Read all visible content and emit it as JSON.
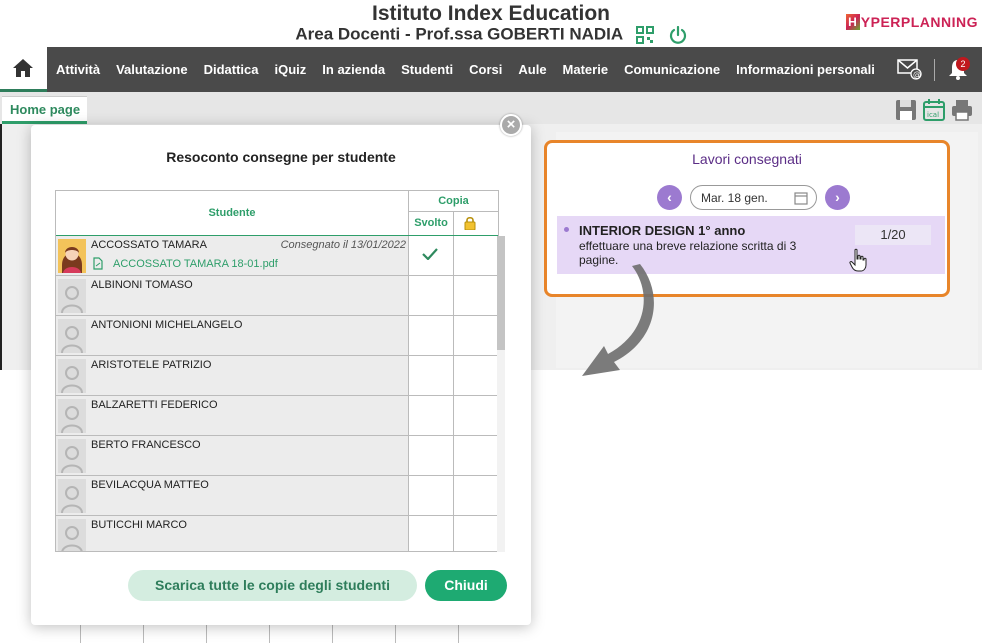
{
  "header": {
    "school": "Istituto Index Education",
    "user": "Area Docenti - Prof.ssa GOBERTI NADIA",
    "logo": "HYPERPLANNING"
  },
  "nav": {
    "items": [
      "Attività",
      "Valutazione",
      "Didattica",
      "iQuiz",
      "In azienda",
      "Studenti",
      "Corsi",
      "Aule",
      "Materie",
      "Comunicazione",
      "Informazioni personali"
    ],
    "notifications": "2"
  },
  "tabs": {
    "home": "Home page"
  },
  "lavori": {
    "title": "Lavori consegnati",
    "date": "Mar. 18 gen.",
    "item_title": "INTERIOR DESIGN 1° anno",
    "item_desc": "effettuare una breve relazione scritta di 3 pagine.",
    "item_count": "1/20"
  },
  "modal": {
    "title": "Resoconto consegne per studente",
    "col_student": "Studente",
    "col_copia": "Copia",
    "col_svolto": "Svolto",
    "students": [
      {
        "name": "ACCOSSATO TAMARA",
        "status": "Consegnato il 13/01/2022",
        "file": "ACCOSSATO TAMARA 18-01.pdf",
        "svolto": true
      },
      {
        "name": "ALBINONI TOMASO"
      },
      {
        "name": "ANTONIONI MICHELANGELO"
      },
      {
        "name": "ARISTOTELE PATRIZIO"
      },
      {
        "name": "BALZARETTI FEDERICO"
      },
      {
        "name": "BERTO FRANCESCO"
      },
      {
        "name": "BEVILACQUA MATTEO"
      },
      {
        "name": "BUTICCHI MARCO"
      }
    ],
    "btn_download": "Scarica tutte le copie degli studenti",
    "btn_close": "Chiudi"
  },
  "colors": {
    "accent": "#2e9e6a",
    "purple": "#9c7ad0",
    "orange": "#e8852a",
    "nav": "#4a4a4a"
  }
}
